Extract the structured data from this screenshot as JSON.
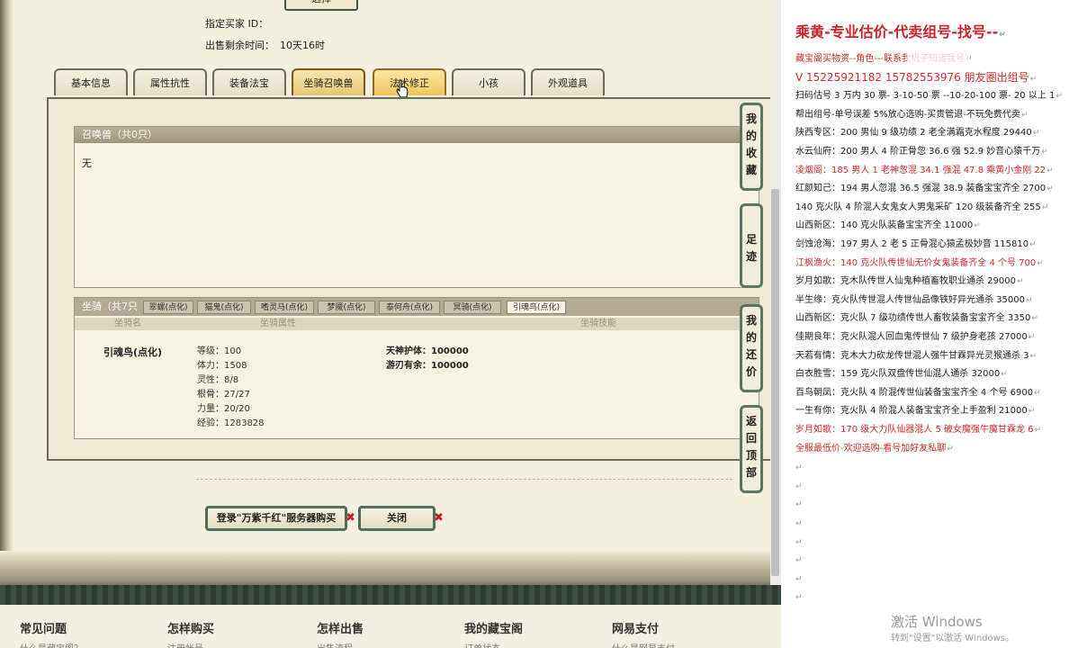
{
  "info": {
    "top_button_label": "选择",
    "designated_buyer_label": "指定买家 ID：",
    "designated_buyer_value": "",
    "remaining_label": "出售剩余时间：",
    "remaining_value": "10天16时"
  },
  "tabs": [
    "基本信息",
    "属性抗性",
    "装备法宝",
    "坐骑召唤兽",
    "法术修正",
    "小孩",
    "外观道具"
  ],
  "summon": {
    "header": "召唤兽（共0只）",
    "empty_text": "无"
  },
  "mounts": {
    "count_label": "坐骑（共7只",
    "tabs": [
      "翠螺(点化)",
      "猫鬼(点化)",
      "嗜灵马(点化)",
      "梦魇(点化)",
      "泰何舟(点化)",
      "冥骑(点化)",
      "引魂鸟(点化)"
    ],
    "columns": [
      "坐骑名",
      "坐骑属性",
      "坐骑技能"
    ],
    "selected": {
      "name": "引魂鸟(点化)",
      "attributes": [
        "等级：100",
        "体力：1508",
        "灵性：8/8",
        "根骨：27/27",
        "力量：20/20",
        "经验：1283828"
      ],
      "skills": [
        "天神护体：100000",
        "游刃有余：100000"
      ]
    }
  },
  "buttons": {
    "login_buy": "登录\"万紫千红\"服务器购买",
    "close": "关闭",
    "x_mark": "✖"
  },
  "side_buttons": [
    "我的收藏",
    "足迹",
    "我的还价",
    "返回顶部"
  ],
  "footer": {
    "items": [
      "常见问题",
      "怎样购买",
      "怎样出售",
      "我的藏宝阁",
      "网易支付"
    ],
    "subs": [
      "什么是藏宝阁？",
      "注册帐号",
      "出售流程",
      "订单状态",
      "什么是网易支付"
    ]
  },
  "doc": {
    "title": "乘黄-专业估价-代卖组号-找号--",
    "lines": [
      {
        "text": "藏宝阁买物资--角色---联系我机子知道我号",
        "red": true
      },
      {
        "text": "V 15225921182    15782553976 朋友圈出组号",
        "red": true
      },
      {
        "text": "扫码估号 3 万内 30 票- 3-10-50 票 --10-20-100 票- 20 以上 1",
        "red": false
      },
      {
        "text": "帮出组号-单号误差 5%放心选购-买贵管退-不玩免费代卖",
        "red": false
      },
      {
        "text": "陕西专区：200 男仙 9 级功绩 2 老全满霜克水程度 29440",
        "red": false
      },
      {
        "text": "水云仙府：200 男人 4 阶正骨忽 36.6 强 52.9 妙音心猿千万",
        "red": false
      },
      {
        "text": "凌烟阁：185 男人 1 老神忽混 34.1 强混 47.8 乘黄小金刚 22",
        "red": true
      },
      {
        "text": "红颜知己：194 男人忽混 36.5 强混 38.9 装备宝宝齐全 2700",
        "red": false
      },
      {
        "text": "140 克火队 4 阶混人女鬼女人男鬼采矿 120 级装备齐全 255",
        "red": false
      },
      {
        "text": "山西新区：140 克火队装备宝宝齐全 11000",
        "red": false
      },
      {
        "text": "剑蚀沧海：197 男人 2 老 5 正骨混心猿孟极妙音 115810",
        "red": false
      },
      {
        "text": "江枫渔火：140 克火队传世仙无价女鬼装备齐全 4 个号 700",
        "red": true
      },
      {
        "text": "岁月如歌：克木队传世人仙鬼种植畜牧职业通杀 29000",
        "red": false
      },
      {
        "text": "半生缘：克火队传世混人传世仙品像铁好异光通杀 35000",
        "red": false
      },
      {
        "text": "山西新区：克火队 7 级功绩传世人畜牧装备宝宝齐全 3350",
        "red": false
      },
      {
        "text": "佳期良年：克火队混人回血鬼传世仙 7 级护身老孩 27000",
        "red": false
      },
      {
        "text": "天若有情：克木大力砍龙传世混人强牛甘霖异光灵猴通杀 3",
        "red": false
      },
      {
        "text": "白衣胜雪：159 克火队双盘传世仙混人通杀 32000",
        "red": false
      },
      {
        "text": "百鸟朝凤：克火队 4 阶混传世仙装备宝宝齐全 4 个号 6900",
        "red": false
      },
      {
        "text": "一生有你：克火队 4 阶混人装备宝宝齐全上手盈利 21000",
        "red": false
      },
      {
        "text": "岁月如歌：170 级大力队仙器混人 5 破女魔强牛魔甘霖龙 6",
        "red": true
      },
      {
        "text": "全服最低价-欢迎选购-看号加好友私聊",
        "red": true
      }
    ],
    "para_mark": "↵",
    "watermark_title": "激活 Windows",
    "watermark_sub": "转到\"设置\"以激活 Windows。"
  }
}
